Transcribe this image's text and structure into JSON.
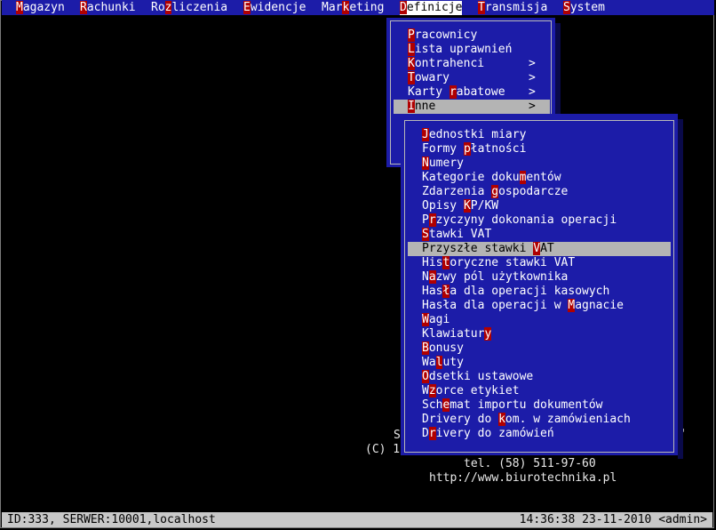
{
  "menubar": {
    "items": [
      {
        "hk": "M",
        "rest": "agazyn",
        "pre": ""
      },
      {
        "hk": "R",
        "rest": "achunki",
        "pre": ""
      },
      {
        "pre": "Ro",
        "hk": "z",
        "rest": "liczenia"
      },
      {
        "hk": "E",
        "rest": "widencje",
        "pre": ""
      },
      {
        "pre": "Mar",
        "hk": "k",
        "rest": "eting"
      },
      {
        "hk": "D",
        "rest": "efinicje",
        "pre": ""
      },
      {
        "hk": "T",
        "rest": "ransmisja",
        "pre": ""
      },
      {
        "hk": "S",
        "rest": "ystem",
        "pre": ""
      }
    ]
  },
  "definicje_menu": {
    "items": [
      {
        "pre": "",
        "hk": "P",
        "rest": "racownicy",
        "arrow": ""
      },
      {
        "pre": "",
        "hk": "L",
        "rest": "ista uprawnień",
        "arrow": ""
      },
      {
        "pre": "",
        "hk": "K",
        "rest": "ontrahenci",
        "arrow": ">"
      },
      {
        "pre": "",
        "hk": "T",
        "rest": "owary",
        "arrow": ">"
      },
      {
        "pre": "Karty ",
        "hk": "r",
        "rest": "abatowe",
        "arrow": ">"
      },
      {
        "pre": "",
        "hk": "I",
        "rest": "nne",
        "arrow": ">"
      }
    ]
  },
  "inne_menu": {
    "items": [
      {
        "pre": "",
        "hk": "J",
        "rest": "ednostki miary"
      },
      {
        "pre": "Formy ",
        "hk": "p",
        "rest": "łatności"
      },
      {
        "pre": "",
        "hk": "N",
        "rest": "umery"
      },
      {
        "pre": "Kategorie doku",
        "hk": "m",
        "rest": "entów"
      },
      {
        "pre": "Zdarzenia ",
        "hk": "g",
        "rest": "ospodarcze"
      },
      {
        "pre": "Opisy ",
        "hk": "K",
        "rest": "P/KW"
      },
      {
        "pre": "P",
        "hk": "r",
        "rest": "zyczyny dokonania operacji"
      },
      {
        "pre": "",
        "hk": "S",
        "rest": "tawki VAT"
      },
      {
        "pre": "Przyszłe stawki ",
        "hk": "V",
        "rest": "AT"
      },
      {
        "pre": "His",
        "hk": "t",
        "rest": "oryczne stawki VAT"
      },
      {
        "pre": "N",
        "hk": "a",
        "rest": "zwy pól użytkownika"
      },
      {
        "pre": "Has",
        "hk": "ł",
        "rest": "a dla operacji kasowych"
      },
      {
        "pre": "Hasła dla operacji w ",
        "hk": "M",
        "rest": "agnacie"
      },
      {
        "pre": "",
        "hk": "W",
        "rest": "agi"
      },
      {
        "pre": "Klawiatur",
        "hk": "y",
        "rest": ""
      },
      {
        "pre": "",
        "hk": "B",
        "rest": "onusy"
      },
      {
        "pre": "Wa",
        "hk": "l",
        "rest": "uty"
      },
      {
        "pre": "",
        "hk": "O",
        "rest": "dsetki ustawowe"
      },
      {
        "pre": "W",
        "hk": "z",
        "rest": "orce etykiet"
      },
      {
        "pre": "Sch",
        "hk": "e",
        "rest": "mat importu dokumentów"
      },
      {
        "pre": "Drivery do ",
        "hk": "k",
        "rest": "om. w zamówieniach"
      },
      {
        "pre": "D",
        "hk": "r",
        "rest": "ivery do zamówień"
      }
    ]
  },
  "background": {
    "s_char": "S",
    "quote_char": "\"",
    "copyright": "(C) 1",
    "phone": "tel. (58) 511-97-60",
    "url": "http://www.biurotechnika.pl"
  },
  "statusbar": {
    "left": "ID:333, SERWER:10001,localhost",
    "right": "14:36:38 23-11-2010 <admin>"
  },
  "colors": {
    "background": "#000000",
    "menu_blue": "#1c1ca8",
    "hotkey_red": "#b00000",
    "selection_gray": "#b4b4b4",
    "statusbar_gray": "#c8c8c8"
  }
}
